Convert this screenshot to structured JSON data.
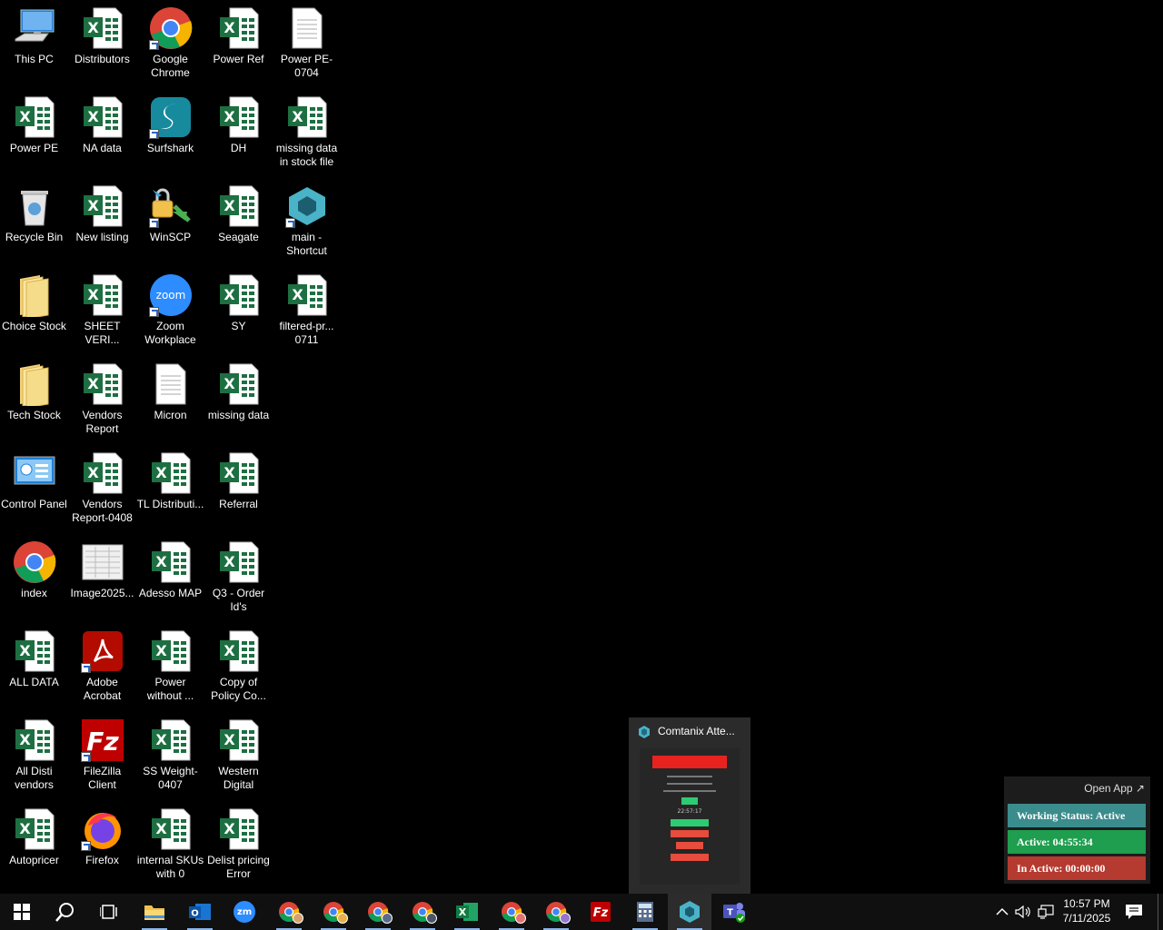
{
  "desktop_icons": [
    {
      "id": "this-pc",
      "label": "This PC",
      "type": "pc"
    },
    {
      "id": "distributors",
      "label": "Distributors",
      "type": "excel"
    },
    {
      "id": "google-chrome",
      "label": "Google Chrome",
      "type": "chrome",
      "shortcut": true
    },
    {
      "id": "power-ref",
      "label": "Power Ref",
      "type": "excel"
    },
    {
      "id": "power-pe-0704",
      "label": "Power PE-0704",
      "type": "doc"
    },
    {
      "id": "power-pe",
      "label": "Power PE",
      "type": "excel"
    },
    {
      "id": "na-data",
      "label": "NA data",
      "type": "excel"
    },
    {
      "id": "surfshark",
      "label": "Surfshark",
      "type": "surfshark",
      "shortcut": true
    },
    {
      "id": "dh",
      "label": "DH",
      "type": "excel"
    },
    {
      "id": "missing-data-stock",
      "label": "missing data in stock file",
      "type": "excel"
    },
    {
      "id": "recycle-bin",
      "label": "Recycle Bin",
      "type": "bin"
    },
    {
      "id": "new-listing",
      "label": "New listing",
      "type": "excel"
    },
    {
      "id": "winscp",
      "label": "WinSCP",
      "type": "winscp",
      "shortcut": true
    },
    {
      "id": "seagate",
      "label": "Seagate",
      "type": "excel"
    },
    {
      "id": "main-shortcut",
      "label": "main - Shortcut",
      "type": "comtanix",
      "shortcut": true
    },
    {
      "id": "choice-stock",
      "label": "Choice Stock",
      "type": "folder"
    },
    {
      "id": "sheet-veri",
      "label": "SHEET VERI...",
      "type": "excel"
    },
    {
      "id": "zoom-workplace",
      "label": "Zoom Workplace",
      "type": "zoom",
      "shortcut": true
    },
    {
      "id": "sy",
      "label": "SY",
      "type": "excel"
    },
    {
      "id": "filtered-pr",
      "label": "filtered-pr... 0711",
      "type": "excel"
    },
    {
      "id": "tech-stock",
      "label": "Tech Stock",
      "type": "folder"
    },
    {
      "id": "vendors-report",
      "label": "Vendors Report",
      "type": "excel"
    },
    {
      "id": "micron",
      "label": "Micron",
      "type": "doc"
    },
    {
      "id": "missing-data",
      "label": "missing data",
      "type": "excel"
    },
    {
      "id": "control-panel",
      "label": "Control Panel",
      "type": "control"
    },
    {
      "id": "vendors-report-0408",
      "label": "Vendors Report-0408",
      "type": "excel"
    },
    {
      "id": "tl-distributi",
      "label": "TL Distributi...",
      "type": "excel"
    },
    {
      "id": "referral",
      "label": "Referral",
      "type": "excel"
    },
    {
      "id": "index",
      "label": "index",
      "type": "chromefile"
    },
    {
      "id": "image2025",
      "label": "Image2025...",
      "type": "image"
    },
    {
      "id": "adesso-map",
      "label": "Adesso MAP",
      "type": "excel"
    },
    {
      "id": "q3-order-ids",
      "label": "Q3 - Order Id's",
      "type": "excel"
    },
    {
      "id": "all-data",
      "label": "ALL DATA",
      "type": "excel"
    },
    {
      "id": "adobe-acrobat",
      "label": "Adobe Acrobat",
      "type": "acrobat",
      "shortcut": true
    },
    {
      "id": "power-without",
      "label": "Power without ...",
      "type": "excel"
    },
    {
      "id": "copy-of-policy",
      "label": "Copy of Policy Co...",
      "type": "excel"
    },
    {
      "id": "all-disti-vendors",
      "label": "All Disti vendors",
      "type": "excel"
    },
    {
      "id": "filezilla-client",
      "label": "FileZilla Client",
      "type": "filezilla",
      "shortcut": true
    },
    {
      "id": "ss-weight",
      "label": "SS Weight-0407",
      "type": "excel"
    },
    {
      "id": "western-digital",
      "label": "Western Digital",
      "type": "excel"
    },
    {
      "id": "autopricer",
      "label": "Autopricer",
      "type": "excel"
    },
    {
      "id": "firefox",
      "label": "Firefox",
      "type": "firefox",
      "shortcut": true
    },
    {
      "id": "internal-skus",
      "label": "internal SKUs with 0",
      "type": "excel"
    },
    {
      "id": "delist-pricing",
      "label": "Delist pricing Error",
      "type": "excel"
    }
  ],
  "preview": {
    "title": "Comtanix Atte...",
    "time_text": "22:57:17"
  },
  "widget": {
    "open_app": "Open App ↗",
    "working_status": "Working Status: Active",
    "active": "Active: 04:55:34",
    "inactive": "In Active: 00:00:00"
  },
  "taskbar": {
    "time": "10:57 PM",
    "date": "7/11/2025",
    "zoom_label": "zm"
  },
  "colors": {
    "excel_green": "#1d6f42",
    "status_teal": "#3b8c8c",
    "status_green": "#1e9e4e",
    "status_red": "#b53a2f"
  }
}
